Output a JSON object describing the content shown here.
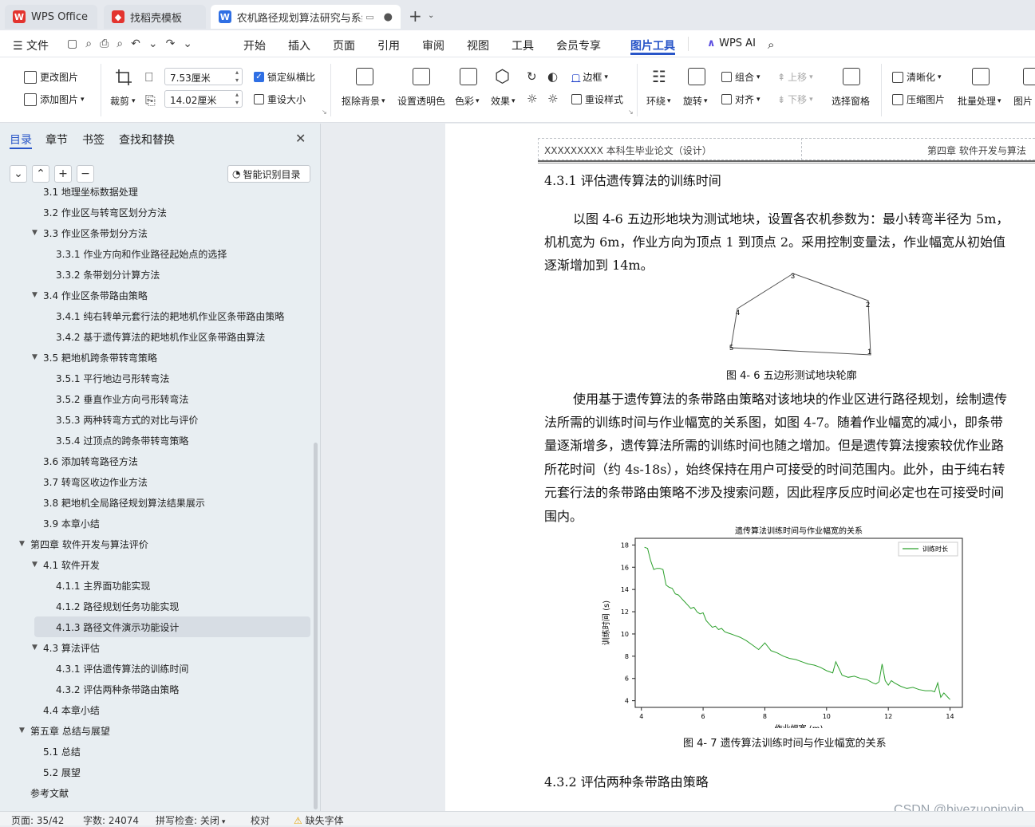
{
  "tabs": [
    {
      "label": "WPS Office"
    },
    {
      "label": "找稻壳模板"
    },
    {
      "label": "农机路径规划算法研究与系统"
    }
  ],
  "menu": {
    "file": "文件",
    "items": [
      "开始",
      "插入",
      "页面",
      "引用",
      "审阅",
      "视图",
      "工具",
      "会员专享",
      "图片工具"
    ],
    "ai": "WPS AI"
  },
  "ribbon": {
    "change_pic": "更改图片",
    "add_pic": "添加图片",
    "crop": "裁剪",
    "width": "7.53厘米",
    "height": "14.02厘米",
    "lock_ratio": "锁定纵横比",
    "resize": "重设大小",
    "remove_bg": "抠除背景",
    "set_transparent": "设置透明色",
    "color": "色彩",
    "effect": "效果",
    "border": "边框",
    "reset_style": "重设样式",
    "wrap": "环绕",
    "rotate": "旋转",
    "group": "组合",
    "align": "对齐",
    "move_up": "上移",
    "move_down": "下移",
    "select_pane": "选择窗格",
    "sharpen": "清晰化",
    "compress": "压缩图片",
    "batch": "批量处理",
    "pic_more": "图片"
  },
  "nav": {
    "tabs": [
      "目录",
      "章节",
      "书签",
      "查找和替换"
    ],
    "smart_toc": "智能识别目录",
    "items": [
      {
        "label": "3.1 地理坐标数据处理",
        "level": 2,
        "arrow": ""
      },
      {
        "label": "3.2 作业区与转弯区划分方法",
        "level": 2,
        "arrow": ""
      },
      {
        "label": "3.3 作业区条带划分方法",
        "level": 2,
        "arrow": "▼"
      },
      {
        "label": "3.3.1 作业方向和作业路径起始点的选择",
        "level": 3,
        "arrow": ""
      },
      {
        "label": "3.3.2 条带划分计算方法",
        "level": 3,
        "arrow": ""
      },
      {
        "label": "3.4 作业区条带路由策略",
        "level": 2,
        "arrow": "▼"
      },
      {
        "label": "3.4.1 纯右转单元套行法的耙地机作业区条带路由策略",
        "level": 3,
        "arrow": ""
      },
      {
        "label": "3.4.2 基于遗传算法的耙地机作业区条带路由算法",
        "level": 3,
        "arrow": ""
      },
      {
        "label": "3.5 耙地机跨条带转弯策略",
        "level": 2,
        "arrow": "▼"
      },
      {
        "label": "3.5.1 平行地边弓形转弯法",
        "level": 3,
        "arrow": ""
      },
      {
        "label": "3.5.2 垂直作业方向弓形转弯法",
        "level": 3,
        "arrow": ""
      },
      {
        "label": "3.5.3 两种转弯方式的对比与评价",
        "level": 3,
        "arrow": ""
      },
      {
        "label": "3.5.4 过顶点的跨条带转弯策略",
        "level": 3,
        "arrow": ""
      },
      {
        "label": "3.6 添加转弯路径方法",
        "level": 2,
        "arrow": ""
      },
      {
        "label": "3.7 转弯区收边作业方法",
        "level": 2,
        "arrow": ""
      },
      {
        "label": "3.8 耙地机全局路径规划算法结果展示",
        "level": 2,
        "arrow": ""
      },
      {
        "label": "3.9 本章小结",
        "level": 2,
        "arrow": ""
      },
      {
        "label": "第四章  软件开发与算法评价",
        "level": 1,
        "arrow": "▼"
      },
      {
        "label": "4.1 软件开发",
        "level": 2,
        "arrow": "▼"
      },
      {
        "label": "4.1.1 主界面功能实现",
        "level": 3,
        "arrow": ""
      },
      {
        "label": "4.1.2 路径规划任务功能实现",
        "level": 3,
        "arrow": ""
      },
      {
        "label": "4.1.3 路径文件演示功能设计",
        "level": 3,
        "arrow": "",
        "selected": true
      },
      {
        "label": "4.3 算法评估",
        "level": 2,
        "arrow": "▼"
      },
      {
        "label": "4.3.1 评估遗传算法的训练时间",
        "level": 3,
        "arrow": ""
      },
      {
        "label": "4.3.2 评估两种条带路由策略",
        "level": 3,
        "arrow": ""
      },
      {
        "label": "4.4 本章小结",
        "level": 2,
        "arrow": ""
      },
      {
        "label": "第五章  总结与展望",
        "level": 1,
        "arrow": "▼"
      },
      {
        "label": "5.1 总结",
        "level": 2,
        "arrow": ""
      },
      {
        "label": "5.2 展望",
        "level": 2,
        "arrow": ""
      },
      {
        "label": "参考文献",
        "level": 1,
        "arrow": ""
      }
    ]
  },
  "doc": {
    "header_left": "XXXXXXXXX 本科生毕业论文（设计）",
    "header_right": "第四章  软件开发与算法",
    "h_431": "4.3.1 评估遗传算法的训练时间",
    "p1": [
      "以图 4-6 五边形地块为测试地块，设置各农机参数为：最小转弯半径为 5m，",
      "机机宽为 6m，作业方向为顶点 1 到顶点 2。采用控制变量法，作业幅宽从初始值",
      "逐渐增加到 14m。"
    ],
    "fig46_caption": "图 4- 6  五边形测试地块轮廓",
    "pentagon_labels": [
      "1",
      "2",
      "3",
      "4",
      "5"
    ],
    "p2": [
      "使用基于遗传算法的条带路由策略对该地块的作业区进行路径规划，绘制遗传",
      "法所需的训练时间与作业幅宽的关系图，如图 4-7。随着作业幅宽的减小，即条带",
      "量逐渐增多，遗传算法所需的训练时间也随之增加。但是遗传算法搜索较优作业路",
      "所花时间（约 4s-18s），始终保持在用户可接受的时间范围内。此外，由于纯右转",
      "元套行法的条带路由策略不涉及搜索问题，因此程序反应时间必定也在可接受时间",
      "围内。"
    ],
    "fig47_caption": "图 4- 7  遗传算法训练时间与作业幅宽的关系",
    "h_432": "4.3.2 评估两种条带路由策略"
  },
  "chart_data": {
    "type": "line",
    "title": "遗传算法训练时间与作业幅宽的关系",
    "xlabel": "作业幅宽 (m)",
    "ylabel": "训练时间 (s)",
    "xlim": [
      3.8,
      14.4
    ],
    "ylim": [
      3.4,
      18.6
    ],
    "xticks": [
      4,
      6,
      8,
      10,
      12,
      14
    ],
    "yticks": [
      4,
      6,
      8,
      10,
      12,
      14,
      16,
      18
    ],
    "legend": "top-right",
    "grid": false,
    "series": [
      {
        "name": "训练时长",
        "color": "#2ca02c",
        "x": [
          4.1,
          4.2,
          4.3,
          4.4,
          4.5,
          4.6,
          4.7,
          4.8,
          4.9,
          5.0,
          5.1,
          5.2,
          5.3,
          5.4,
          5.5,
          5.6,
          5.7,
          5.8,
          5.9,
          6.0,
          6.1,
          6.2,
          6.3,
          6.4,
          6.5,
          6.6,
          6.7,
          6.8,
          6.9,
          7.0,
          7.2,
          7.4,
          7.6,
          7.8,
          8.0,
          8.2,
          8.4,
          8.6,
          8.8,
          9.0,
          9.2,
          9.4,
          9.6,
          9.8,
          10.0,
          10.1,
          10.2,
          10.3,
          10.5,
          10.7,
          10.9,
          11.1,
          11.3,
          11.5,
          11.6,
          11.7,
          11.8,
          11.9,
          12.0,
          12.1,
          12.2,
          12.4,
          12.6,
          12.8,
          13.0,
          13.2,
          13.4,
          13.5,
          13.6,
          13.7,
          13.8,
          13.9,
          14.0
        ],
        "y": [
          17.8,
          17.7,
          16.6,
          15.8,
          15.9,
          15.9,
          15.8,
          14.4,
          14.2,
          14.1,
          13.6,
          13.5,
          13.2,
          12.9,
          12.6,
          12.3,
          12.4,
          12.0,
          11.8,
          11.9,
          11.2,
          10.9,
          10.6,
          10.7,
          10.4,
          10.5,
          10.2,
          10.1,
          10.0,
          9.9,
          9.7,
          9.4,
          9.0,
          8.6,
          9.2,
          8.5,
          8.3,
          8.0,
          7.8,
          7.7,
          7.5,
          7.3,
          7.2,
          7.0,
          6.7,
          6.6,
          6.5,
          7.5,
          6.3,
          6.1,
          6.2,
          6.0,
          5.9,
          5.6,
          5.5,
          5.7,
          7.3,
          5.8,
          5.4,
          5.8,
          5.6,
          5.3,
          5.1,
          5.2,
          5.0,
          4.9,
          4.9,
          4.8,
          5.6,
          4.3,
          4.7,
          4.4,
          4.1
        ]
      }
    ]
  },
  "status": {
    "page": "页面: 35/42",
    "words": "字数: 24074",
    "spell": "拼写检查: 关闭",
    "proof": "校对",
    "font_missing": "缺失字体"
  },
  "watermark": "CSDN @biyezuopinvip"
}
